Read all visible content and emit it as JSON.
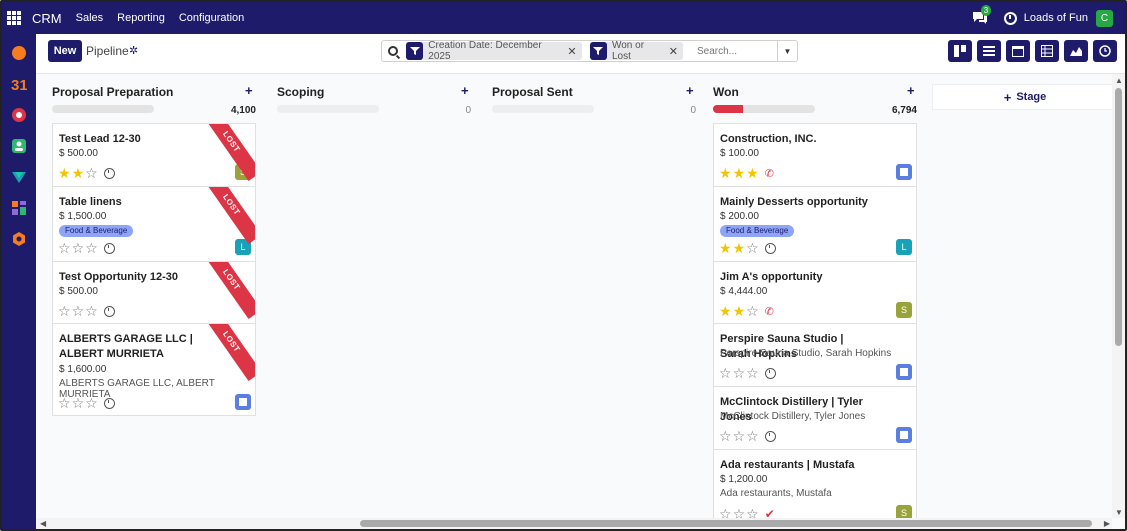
{
  "topbar": {
    "app_name": "CRM",
    "menu": [
      "Sales",
      "Reporting",
      "Configuration"
    ],
    "chat_count": "3",
    "company": "Loads of Fun",
    "user_initial": "C"
  },
  "control_panel": {
    "new_label": "New",
    "breadcrumb": "Pipeline",
    "facets": [
      {
        "text": "Creation Date: December 2025"
      },
      {
        "text": "Won or Lost"
      }
    ],
    "search_placeholder": "Search..."
  },
  "columns": [
    {
      "title": "Proposal Preparation",
      "total": "4,100",
      "progress_lost_fraction": 0
    },
    {
      "title": "Scoping",
      "total": "0",
      "progress_lost_fraction": 0
    },
    {
      "title": "Proposal Sent",
      "total": "0",
      "progress_lost_fraction": 0
    },
    {
      "title": "Won",
      "total": "6,794",
      "progress_lost_fraction": 0.29
    }
  ],
  "cards": {
    "c1": {
      "title": "Test Lead 12-30",
      "amount": "$ 500.00",
      "ribbon": "LOST",
      "stars": 2,
      "owner": "S",
      "owner_color": "#9aa33a"
    },
    "c2": {
      "title": "Table linens",
      "amount": "$ 1,500.00",
      "tag": "Food & Beverage",
      "ribbon": "LOST",
      "stars": 0,
      "owner": "L",
      "owner_color": "#17a2b8"
    },
    "c3": {
      "title": "Test Opportunity 12-30",
      "amount": "$ 500.00",
      "ribbon": "LOST",
      "stars": 0
    },
    "c4": {
      "title": "ALBERTS GARAGE LLC | ALBERT MURRIETA",
      "amount": "$ 1,600.00",
      "partner": "ALBERTS GARAGE LLC, ALBERT MURRIETA",
      "ribbon": "LOST",
      "stars": 0
    },
    "w1": {
      "title": "Construction, INC.",
      "amount": "$ 100.00",
      "stars": 3
    },
    "w2": {
      "title": "Mainly Desserts opportunity",
      "amount": "$ 200.00",
      "tag": "Food & Beverage",
      "stars": 2,
      "owner": "L"
    },
    "w3": {
      "title": "Jim A's opportunity",
      "amount": "$ 4,444.00",
      "stars": 2,
      "owner": "S"
    },
    "w4": {
      "title": "Perspire Sauna Studio | Sarah Hopkins",
      "partner": "Perspire Sauna Studio, Sarah Hopkins",
      "stars": 0
    },
    "w5": {
      "title": "McClintock Distillery | Tyler Jones",
      "partner": "McClintock Distillery, Tyler Jones",
      "stars": 0
    },
    "w6": {
      "title": "Ada restaurants | Mustafa",
      "amount": "$ 1,200.00",
      "partner": "Ada restaurants, Mustafa",
      "stars": 0,
      "owner": "S"
    }
  },
  "stage_button": "Stage",
  "colors": {
    "primary": "#1e1b6b",
    "lost": "#dc3545",
    "star": "#f3c400"
  }
}
